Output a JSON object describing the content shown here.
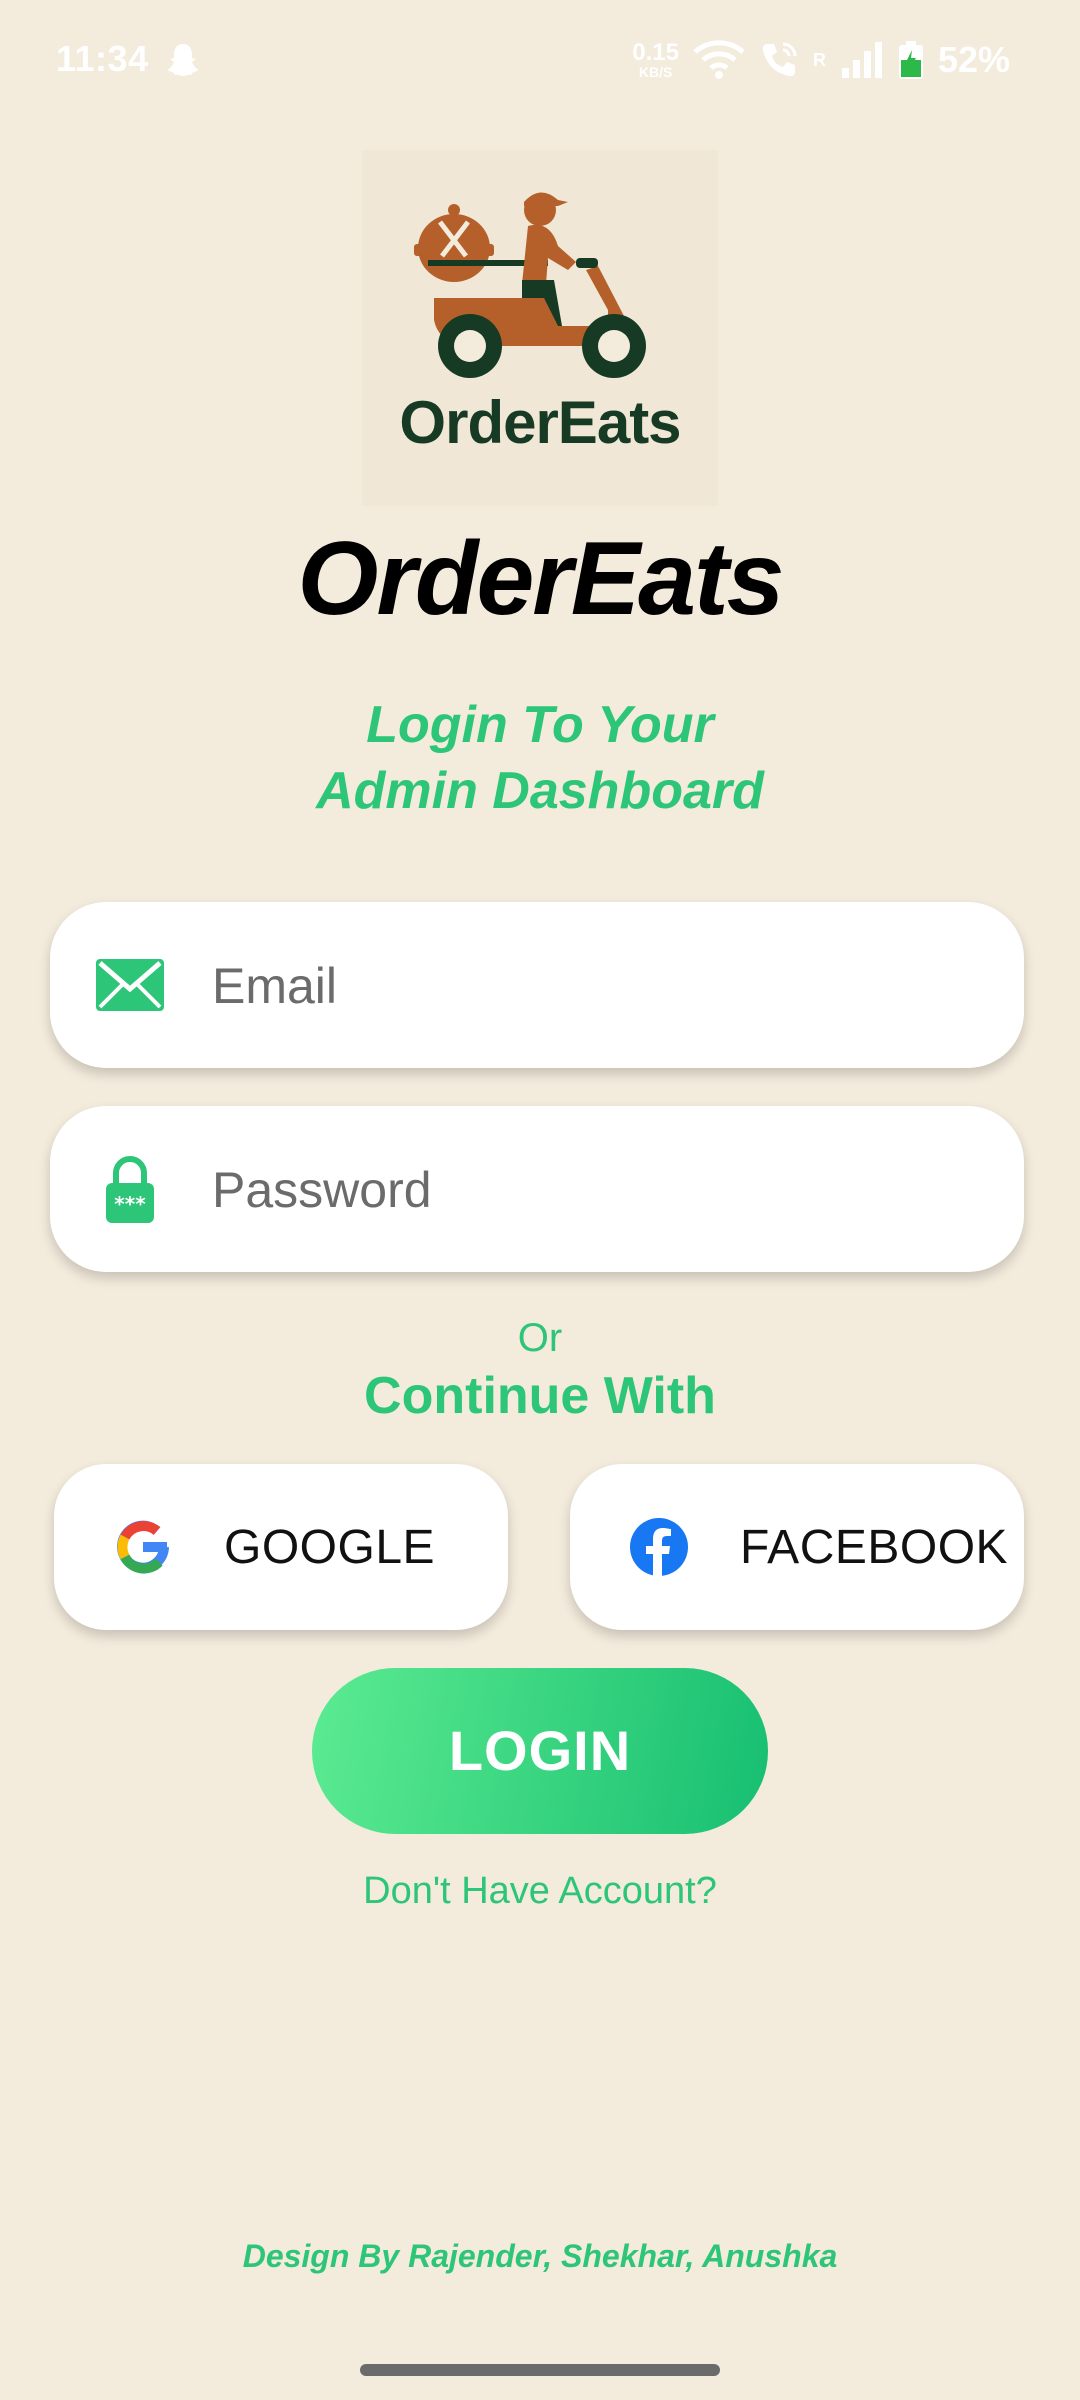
{
  "status_bar": {
    "time": "11:34",
    "net_speed_value": "0.15",
    "net_speed_unit": "KB/S",
    "roaming_label": "R",
    "battery_percent": "52%"
  },
  "logo": {
    "text": "OrderEats"
  },
  "app_title": "OrderEats",
  "subtitle": {
    "line1": "Login To Your",
    "line2": "Admin Dashboard"
  },
  "form": {
    "email_placeholder": "Email",
    "password_placeholder": "Password"
  },
  "divider": {
    "or": "Or",
    "continue_with": "Continue With"
  },
  "social": {
    "google_label": "GOOGLE",
    "facebook_label": "FACEBOOK"
  },
  "login_button": "LOGIN",
  "signup_link": "Don't Have Account?",
  "credits": "Design By Rajender, Shekhar, Anushka",
  "colors": {
    "background": "#f3ebdc",
    "accent_green": "#2dc577",
    "logo_brown": "#b5602a",
    "logo_dark_green": "#163a24"
  }
}
